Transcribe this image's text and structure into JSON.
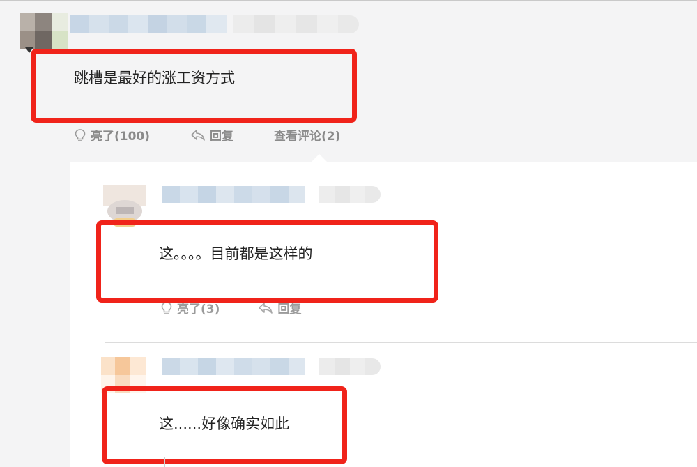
{
  "comment": {
    "text": "跳槽是最好的涨工资方式",
    "actions": {
      "like_label": "亮了(100)",
      "reply_label": "回复",
      "view_replies_label": "查看评论(2)"
    }
  },
  "replies": [
    {
      "text": "这。。。。目前都是这样的",
      "actions": {
        "like_label": "亮了(3)",
        "reply_label": "回复"
      }
    },
    {
      "text": "这......好像确实如此"
    }
  ],
  "colors": {
    "highlight_border": "#f0231a",
    "action_text": "#8a8a8a",
    "page_background": "#f4f4f5",
    "panel_background": "#ffffff"
  },
  "icons": [
    "lightbulb-icon",
    "reply-arrow-icon"
  ]
}
